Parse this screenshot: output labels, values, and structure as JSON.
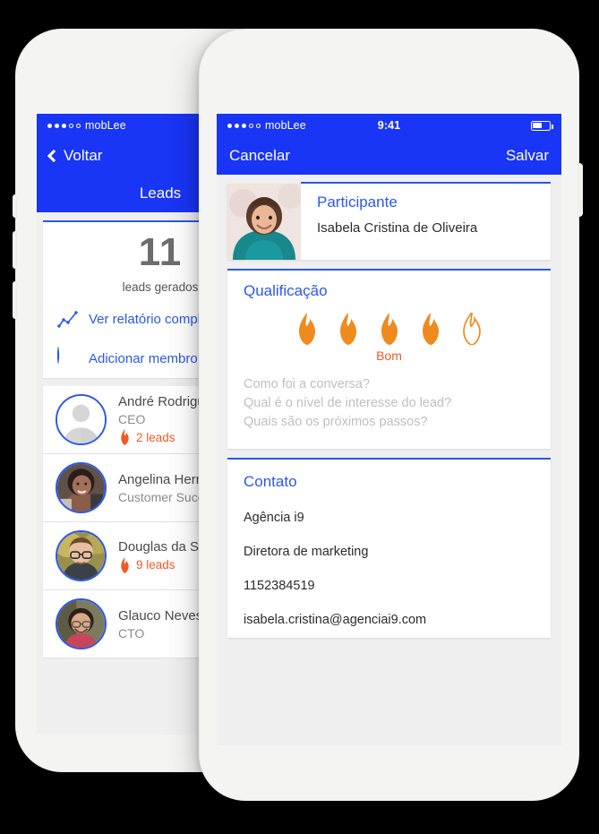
{
  "background_color": "#000000",
  "accent_blue": "#1935f5",
  "link_blue": "#2b58e8",
  "flame_orange": "#ef8a1e",
  "badge_orange": "#ef5a28",
  "left_phone": {
    "status_bar": {
      "carrier": "mobLee",
      "signal_filled": 3,
      "signal_total": 5,
      "time": "",
      "battery_level": 55
    },
    "nav": {
      "back_label": "Voltar",
      "back_icon": "chevron-left-icon",
      "right_label": "Leads"
    },
    "title": "Leads",
    "stats": {
      "count": "11",
      "caption": "leads gerados"
    },
    "actions": [
      {
        "icon": "line-chart-icon",
        "label": "Ver relatório completo"
      },
      {
        "icon": "plus-circle-icon",
        "label": "Adicionar membro"
      }
    ],
    "leads": [
      {
        "name": "André Rodrigues",
        "role": "CEO",
        "badge": "2 leads",
        "avatar": "placeholder-avatar"
      },
      {
        "name": "Angelina Hernandez",
        "role": "Customer Success",
        "badge": "",
        "avatar": "photo-avatar"
      },
      {
        "name": "Douglas da Silva",
        "role": "",
        "badge": "9 leads",
        "avatar": "photo-avatar"
      },
      {
        "name": "Glauco Neves",
        "role": "CTO",
        "badge": "",
        "avatar": "photo-avatar"
      }
    ]
  },
  "right_phone": {
    "status_bar": {
      "carrier": "mobLee",
      "signal_filled": 3,
      "signal_total": 5,
      "time": "9:41",
      "battery_level": 55
    },
    "nav": {
      "cancel_label": "Cancelar",
      "save_label": "Salvar"
    },
    "participant": {
      "section_title": "Participante",
      "name": "Isabela Cristina de Oliveira",
      "photo": "participant-photo"
    },
    "qualification": {
      "section_title": "Qualificação",
      "rating": 4,
      "max_rating": 5,
      "rating_label": "Bom",
      "notes_placeholder_lines": [
        "Como foi a conversa?",
        "Qual é o nível de interesse do lead?",
        "Quais são os próximos passos?"
      ]
    },
    "contact": {
      "section_title": "Contato",
      "company": "Agência i9",
      "role": "Diretora de marketing",
      "phone": "1152384519",
      "email": "isabela.cristina@agenciai9.com"
    }
  }
}
